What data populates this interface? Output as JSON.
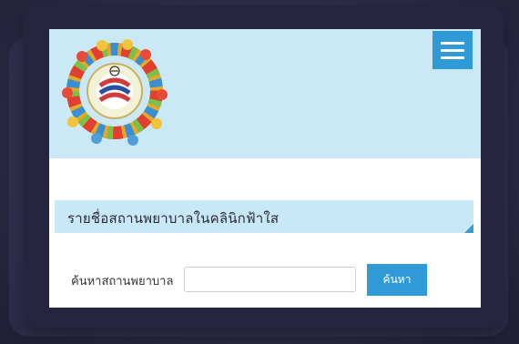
{
  "header": {
    "logo_icon": "clinic-logo-icon",
    "menu_icon": "hamburger-menu-icon"
  },
  "main": {
    "section_title": "รายชื่อสถานพยาบาลในคลินิกฟ้าใส",
    "search": {
      "label": "ค้นหาสถานพยาบาล",
      "placeholder": "",
      "value": "",
      "button_label": "ค้นหา"
    }
  },
  "colors": {
    "header_bg": "#cbe8f6",
    "accent": "#2f9ad6",
    "frame": "#25253f"
  }
}
